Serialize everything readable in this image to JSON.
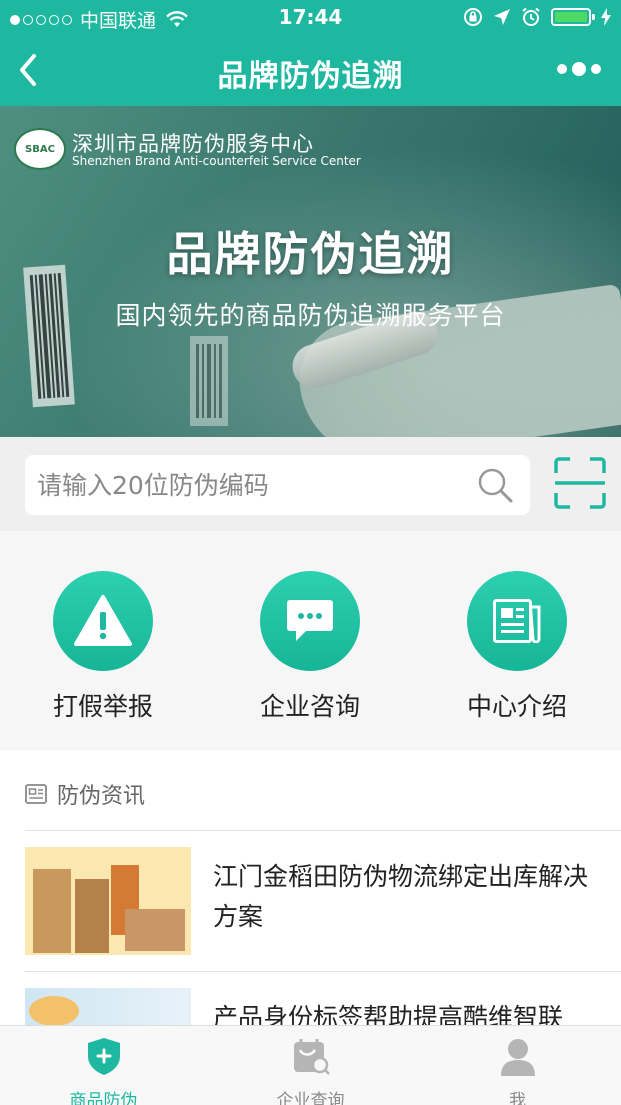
{
  "status_bar": {
    "carrier": "中国联通",
    "time": "17:44"
  },
  "navbar": {
    "title": "品牌防伪追溯"
  },
  "banner": {
    "center_name": "深圳市品牌防伪服务中心",
    "center_name_en": "Shenzhen Brand Anti-counterfeit Service Center",
    "logo_text": "SBAC",
    "title": "品牌防伪追溯",
    "subtitle": "国内领先的商品防伪追溯服务平台"
  },
  "search": {
    "placeholder": "请输入20位防伪编码"
  },
  "actions": [
    {
      "label": "打假举报",
      "icon": "warning-icon"
    },
    {
      "label": "企业咨询",
      "icon": "chat-icon"
    },
    {
      "label": "中心介绍",
      "icon": "newspaper-icon"
    }
  ],
  "news": {
    "header": "防伪资讯",
    "items": [
      {
        "title": "江门金稻田防伪物流绑定出库解决方案"
      },
      {
        "title": "产品身份标签帮助提高酷维智联"
      }
    ]
  },
  "tabbar": {
    "tabs": [
      {
        "label": "商品防伪",
        "active": true
      },
      {
        "label": "企业查询",
        "active": false
      },
      {
        "label": "我",
        "active": false
      }
    ]
  },
  "colors": {
    "brand": "#1eb8a0",
    "accent_gradient_top": "#2cd0b0",
    "accent_gradient_bottom": "#17b597"
  }
}
